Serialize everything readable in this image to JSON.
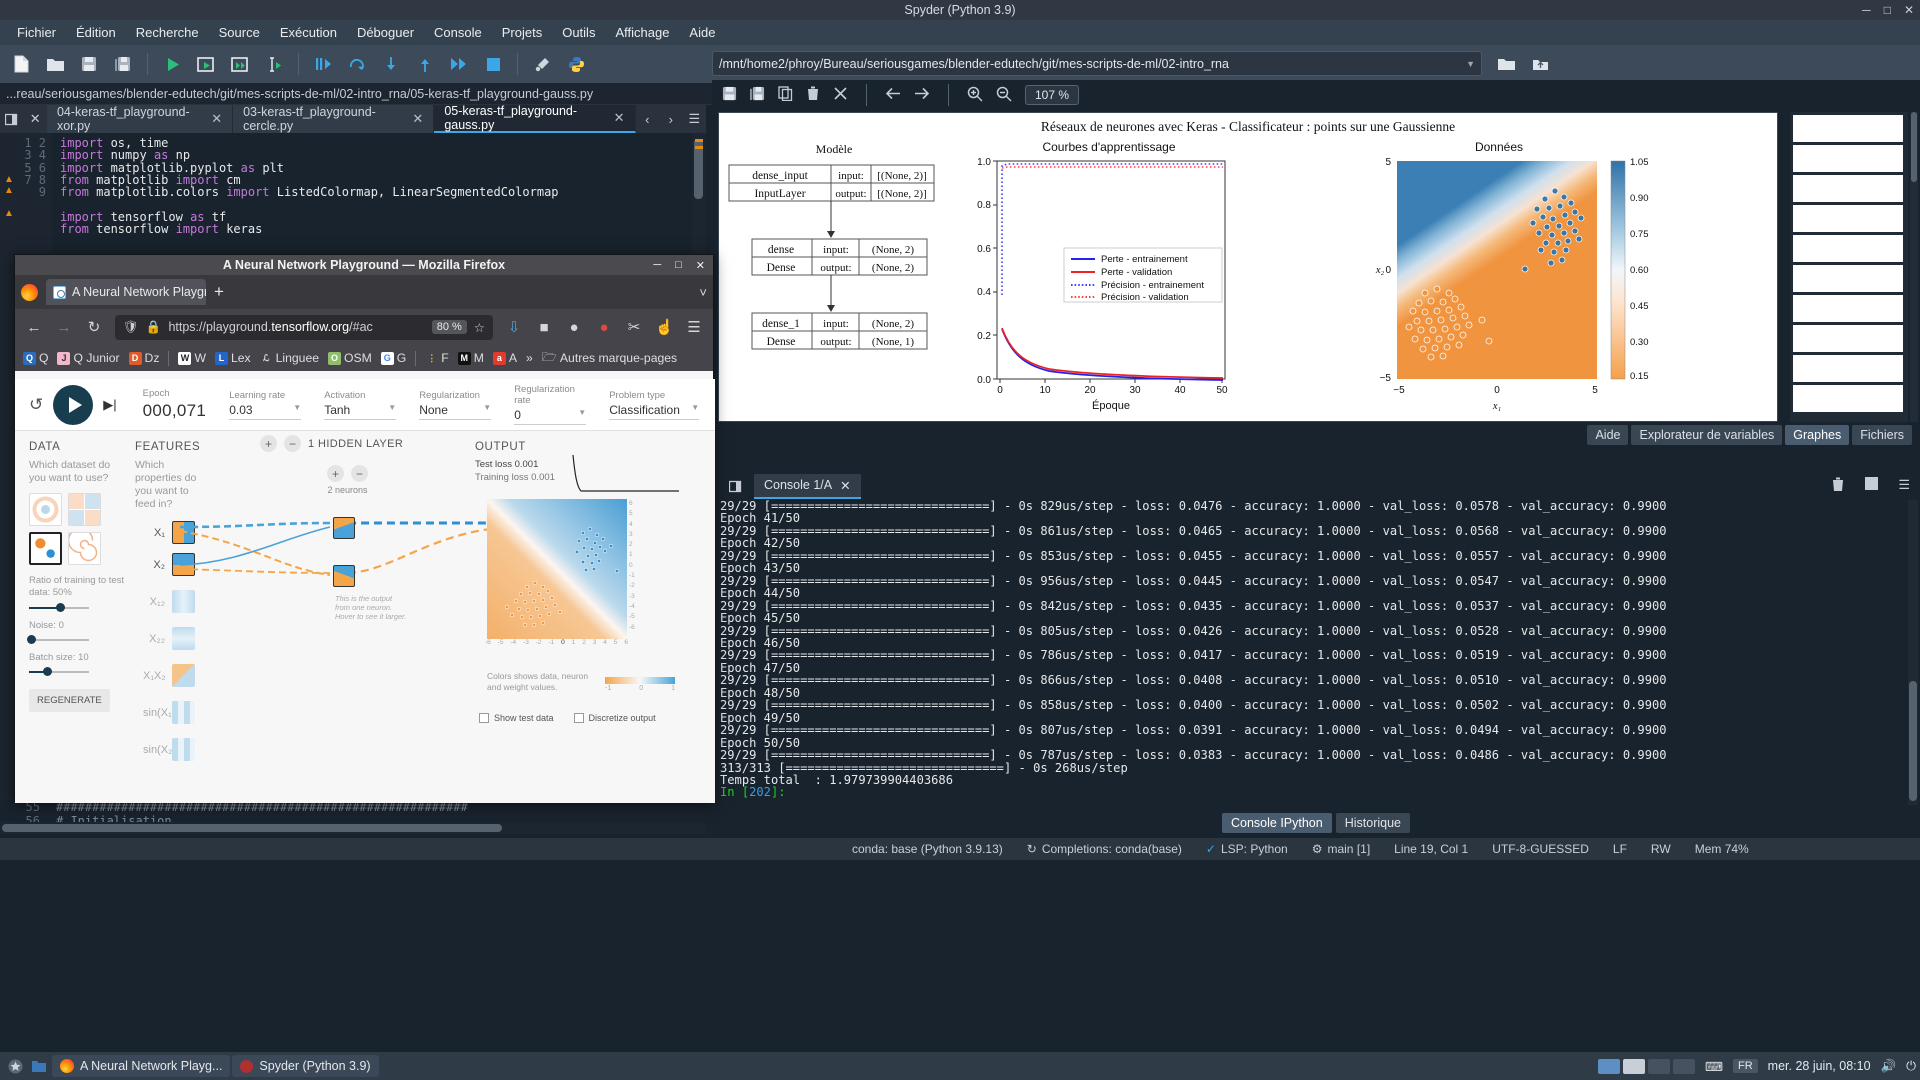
{
  "spyder": {
    "title": "Spyder (Python 3.9)",
    "menu": [
      "Fichier",
      "Édition",
      "Recherche",
      "Source",
      "Exécution",
      "Déboguer",
      "Console",
      "Projets",
      "Outils",
      "Affichage",
      "Aide"
    ],
    "path_value": "/mnt/home2/phroy/Bureau/seriousgames/blender-edutech/git/mes-scripts-de-ml/02-intro_rna",
    "breadcrumb": "...reau/seriousgames/blender-edutech/git/mes-scripts-de-ml/02-intro_rna/05-keras-tf_playground-gauss.py",
    "editor": {
      "tabs": [
        {
          "label": "04-keras-tf_playground-xor.py",
          "active": false
        },
        {
          "label": "03-keras-tf_playground-cercle.py",
          "active": false
        },
        {
          "label": "05-keras-tf_playground-gauss.py",
          "active": true
        }
      ],
      "lines": [
        {
          "n": "1",
          "text": "import os, time",
          "warn": false
        },
        {
          "n": "2",
          "text": "import numpy as np",
          "warn": false
        },
        {
          "n": "3",
          "text": "import matplotlib.pyplot as plt",
          "warn": false
        },
        {
          "n": "4",
          "text": "from matplotlib import cm",
          "warn": true
        },
        {
          "n": "5",
          "text": "from matplotlib.colors import ListedColormap, LinearSegmentedColormap",
          "warn": true
        },
        {
          "n": "6",
          "text": "",
          "warn": false
        },
        {
          "n": "7",
          "text": "import tensorflow as tf",
          "warn": true
        },
        {
          "n": "8",
          "text": "from tensorflow import keras",
          "warn": false
        },
        {
          "n": "9",
          "text": "",
          "warn": false
        }
      ],
      "bottom_lines": [
        {
          "n": "55",
          "text": "#########################################################"
        },
        {
          "n": "56",
          "text": "# Initialisation"
        }
      ]
    },
    "plots": {
      "zoom": "107 %",
      "tabs": [
        "Aide",
        "Explorateur de variables",
        "Graphes",
        "Fichiers"
      ],
      "active_tab": "Graphes"
    },
    "console": {
      "tab_label": "Console 1/A",
      "bottom_tabs": [
        "Console IPython",
        "Historique"
      ],
      "active_bottom_tab": "Console IPython",
      "output": "29/29 [==============================] - 0s 829us/step - loss: 0.0476 - accuracy: 1.0000 - val_loss: 0.0578 - val_accuracy: 0.9900\nEpoch 41/50\n29/29 [==============================] - 0s 861us/step - loss: 0.0465 - accuracy: 1.0000 - val_loss: 0.0568 - val_accuracy: 0.9900\nEpoch 42/50\n29/29 [==============================] - 0s 853us/step - loss: 0.0455 - accuracy: 1.0000 - val_loss: 0.0557 - val_accuracy: 0.9900\nEpoch 43/50\n29/29 [==============================] - 0s 956us/step - loss: 0.0445 - accuracy: 1.0000 - val_loss: 0.0547 - val_accuracy: 0.9900\nEpoch 44/50\n29/29 [==============================] - 0s 842us/step - loss: 0.0435 - accuracy: 1.0000 - val_loss: 0.0537 - val_accuracy: 0.9900\nEpoch 45/50\n29/29 [==============================] - 0s 805us/step - loss: 0.0426 - accuracy: 1.0000 - val_loss: 0.0528 - val_accuracy: 0.9900\nEpoch 46/50\n29/29 [==============================] - 0s 786us/step - loss: 0.0417 - accuracy: 1.0000 - val_loss: 0.0519 - val_accuracy: 0.9900\nEpoch 47/50\n29/29 [==============================] - 0s 866us/step - loss: 0.0408 - accuracy: 1.0000 - val_loss: 0.0510 - val_accuracy: 0.9900\nEpoch 48/50\n29/29 [==============================] - 0s 858us/step - loss: 0.0400 - accuracy: 1.0000 - val_loss: 0.0502 - val_accuracy: 0.9900\nEpoch 49/50\n29/29 [==============================] - 0s 807us/step - loss: 0.0391 - accuracy: 1.0000 - val_loss: 0.0494 - val_accuracy: 0.9900\nEpoch 50/50\n29/29 [==============================] - 0s 787us/step - loss: 0.0383 - accuracy: 1.0000 - val_loss: 0.0486 - val_accuracy: 0.9900\n313/313 [==============================] - 0s 268us/step\nTemps total  : 1.979739904403686",
      "prompt_prefix": "In [",
      "prompt_num": "202",
      "prompt_suffix": "]:"
    },
    "status": {
      "conda": "conda: base (Python 3.9.13)",
      "completions": "Completions: conda(base)",
      "lsp": "LSP: Python",
      "branch": "main [1]",
      "cursor": "Line 19, Col 1",
      "encoding": "UTF-8-GUESSED",
      "eol": "LF",
      "rw": "RW",
      "mem": "Mem 74%"
    }
  },
  "chart_data": {
    "type": "line",
    "title": "Réseaux de neurones avec Keras - Classificateur : points sur une Gaussienne",
    "panels": [
      {
        "name": "modele",
        "title": "Modèle",
        "type": "table",
        "blocks": [
          {
            "name": "dense_input",
            "type": "InputLayer",
            "input": "[(None, 2)]",
            "output": "[(None, 2)]",
            "input_label": "input:",
            "output_label": "output:"
          },
          {
            "name": "dense",
            "type": "Dense",
            "input": "(None, 2)",
            "output": "(None, 2)",
            "input_label": "input:",
            "output_label": "output:"
          },
          {
            "name": "dense_1",
            "type": "Dense",
            "input": "(None, 2)",
            "output": "(None, 1)",
            "input_label": "input:",
            "output_label": "output:"
          }
        ]
      },
      {
        "name": "courbes",
        "title": "Courbes d'apprentissage",
        "xlabel": "Époque",
        "xticks": [
          "0",
          "10",
          "20",
          "30",
          "40",
          "50"
        ],
        "yticks": [
          "0.0",
          "0.2",
          "0.4",
          "0.6",
          "0.8",
          "1.0"
        ],
        "xlim": [
          0,
          50
        ],
        "ylim": [
          0.0,
          1.0
        ],
        "legend": [
          {
            "label": "Perte - entrainement",
            "color": "#2222ee",
            "style": "solid"
          },
          {
            "label": "Perte - validation",
            "color": "#ee2222",
            "style": "solid"
          },
          {
            "label": "Précision - entrainement",
            "color": "#4444ff",
            "style": "dotted"
          },
          {
            "label": "Précision - validation",
            "color": "#ff4444",
            "style": "dotted"
          }
        ],
        "series": [
          {
            "name": "Perte - entrainement",
            "values": [
              0.23,
              0.14,
              0.105,
              0.085,
              0.072,
              0.063,
              0.056,
              0.05,
              0.045,
              0.041,
              0.038
            ]
          },
          {
            "name": "Perte - validation",
            "values": [
              0.235,
              0.148,
              0.112,
              0.092,
              0.079,
              0.07,
              0.063,
              0.057,
              0.053,
              0.049,
              0.0486
            ]
          },
          {
            "name": "Précision - entrainement",
            "values": [
              0.61,
              1.0,
              1.0,
              1.0,
              1.0,
              1.0,
              1.0,
              1.0,
              1.0,
              1.0,
              1.0
            ]
          },
          {
            "name": "Précision - validation",
            "values": [
              0.985,
              0.99,
              0.99,
              0.99,
              0.99,
              0.99,
              0.99,
              0.99,
              0.99,
              0.99,
              0.99
            ]
          }
        ]
      },
      {
        "name": "donnees",
        "title": "Données",
        "xlabel": "x₁",
        "ylabel": "x₂",
        "xticks": [
          "-5",
          "0",
          "5"
        ],
        "yticks": [
          "-5",
          "0",
          "5"
        ],
        "colorbar_ticks": [
          "0.15",
          "0.30",
          "0.45",
          "0.60",
          "0.75",
          "0.90",
          "1.05"
        ],
        "type": "scatter"
      }
    ]
  },
  "firefox": {
    "title": "A Neural Network Playground — Mozilla Firefox",
    "tab_label": "A Neural Network Playgr",
    "url_text": "https://playground.",
    "url_host": "tensorflow.org",
    "url_tail": "/#ac",
    "zoom": "80 %",
    "bookmarks": [
      {
        "label": "Q",
        "icon": "Q"
      },
      {
        "label": "Q Junior",
        "icon": "J"
      },
      {
        "label": "Dz",
        "icon": "D"
      },
      {
        "label": "W",
        "icon": "W"
      },
      {
        "label": "Lex",
        "icon": "L"
      },
      {
        "label": "Linguee",
        "icon": "ℒ"
      },
      {
        "label": "OSM",
        "icon": "O"
      },
      {
        "label": "G",
        "icon": "G"
      },
      {
        "label": "F",
        "icon": "F"
      },
      {
        "label": "M",
        "icon": "M"
      },
      {
        "label": "A",
        "icon": "a"
      }
    ],
    "bookmarks_more": "»",
    "other_bookmarks": "Autres marque-pages",
    "playground": {
      "epoch_label": "Epoch",
      "epoch_value": "000,071",
      "learning_rate_label": "Learning rate",
      "learning_rate_value": "0.03",
      "activation_label": "Activation",
      "activation_value": "Tanh",
      "regularization_label": "Regularization",
      "regularization_value": "None",
      "regularization_rate_label": "Regularization rate",
      "regularization_rate_value": "0",
      "problem_type_label": "Problem type",
      "problem_type_value": "Classification",
      "data_header": "DATA",
      "data_sub": "Which dataset do you want to use?",
      "ratio_label": "Ratio of training to test data:  50%",
      "noise_label": "Noise:  0",
      "batch_label": "Batch size:  10",
      "regenerate_label": "REGENERATE",
      "features_header": "FEATURES",
      "features_sub": "Which properties do you want to feed in?",
      "features": [
        "X₁",
        "X₂",
        "X₁₂",
        "X₂₂",
        "X₁X₂",
        "sin(X₁)",
        "sin(X₂)"
      ],
      "hidden_layer_label": "1  HIDDEN LAYER",
      "neurons_label": "2 neurons",
      "output_header": "OUTPUT",
      "test_loss": "Test loss 0.001",
      "training_loss": "Training loss 0.001",
      "neuron_hint": "This is the output from one neuron. Hover to see it larger.",
      "colors_note": "Colors shows data, neuron and weight values.",
      "color_min": "-1",
      "color_mid": "0",
      "color_max": "1",
      "show_test_data": "Show test data",
      "discretize_output": "Discretize output",
      "out_yticks": [
        "6",
        "5",
        "4",
        "3",
        "2",
        "1",
        "0",
        "-1",
        "-2",
        "-3",
        "-4",
        "-5",
        "-6"
      ],
      "out_xticks": [
        "-6",
        "-5",
        "-4",
        "-3",
        "-2",
        "-1",
        "0",
        "1",
        "2",
        "3",
        "4",
        "5",
        "6"
      ]
    }
  },
  "taskbar": {
    "apps": [
      {
        "label": "A Neural Network Playg..."
      },
      {
        "label": "Spyder (Python 3.9)"
      }
    ],
    "lang": "FR",
    "clock": "mer. 28 juin, 08:10"
  }
}
